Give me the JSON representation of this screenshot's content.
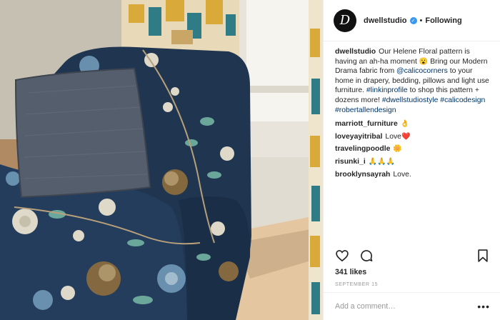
{
  "post": {
    "username": "dwellstudio",
    "avatar_letter": "D",
    "verified_glyph": "✓",
    "separator": "•",
    "follow_status": "Following"
  },
  "photo": {
    "accent_colors": {
      "chair_navy": "#1f3550",
      "pillow": "#555e6c",
      "curtain_gold": "#d9a93a",
      "curtain_teal": "#2f7c86",
      "floor": "#e3c9a6",
      "wall": "#c9c3b6"
    }
  },
  "caption": {
    "author": "dwellstudio",
    "part1": "Our Helene Floral pattern is having an ah-ha moment",
    "emoji1": "😮",
    "part2": "Bring our Modern Drama fabric from",
    "mention": "@calicocorners",
    "part3": "to your home in drapery, bedding, pillows and light use furniture.",
    "hashtag1": "#linkinprofile",
    "part4": "to shop this pattern + dozens more!",
    "hashtag2": "#dwellstudiostyle",
    "hashtag3": "#calicodesign",
    "hashtag4": "#robertallendesign"
  },
  "comments": [
    {
      "user": "marriott_furniture",
      "text": "",
      "emoji": "👌"
    },
    {
      "user": "loveyayitribal",
      "text": "Love",
      "emoji": "❤️"
    },
    {
      "user": "travelingpoodle",
      "text": "",
      "emoji": "🌼"
    },
    {
      "user": "risunki_i",
      "text": "",
      "emoji": "🙏🙏🙏"
    },
    {
      "user": "brooklynsayrah",
      "text": "Love.",
      "emoji": ""
    }
  ],
  "actions": {
    "like_icon": "heart-icon",
    "comment_icon": "comment-icon",
    "save_icon": "bookmark-icon"
  },
  "likes_text": "341 likes",
  "date_text": "SEPTEMBER 15",
  "add_comment": {
    "placeholder": "Add a comment…",
    "more_label": "•••"
  }
}
